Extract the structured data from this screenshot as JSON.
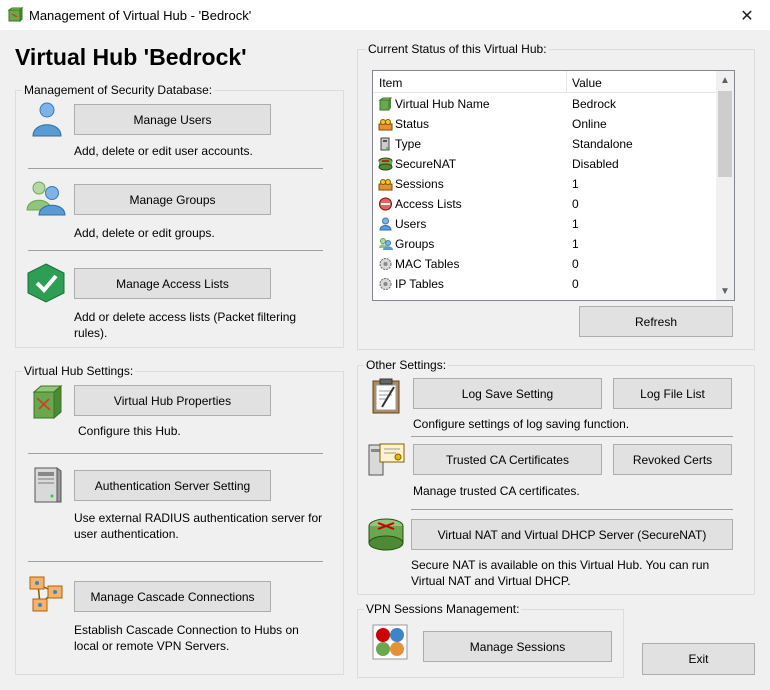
{
  "window": {
    "title": "Management of Virtual Hub - 'Bedrock'",
    "close_glyph": "✕"
  },
  "heading": "Virtual Hub 'Bedrock'",
  "security_db": {
    "label": "Management of Security Database:",
    "manage_users": "Manage Users",
    "users_desc": "Add, delete or edit user accounts.",
    "manage_groups": "Manage Groups",
    "groups_desc": "Add, delete or edit groups.",
    "manage_access": "Manage Access Lists",
    "access_desc": "Add or delete access lists (Packet filtering rules)."
  },
  "hub_settings": {
    "label": "Virtual Hub Settings:",
    "properties": "Virtual Hub Properties",
    "properties_desc": "Configure this Hub.",
    "auth_server": "Authentication Server Setting",
    "auth_desc": "Use external RADIUS authentication server for user authentication.",
    "cascade": "Manage Cascade Connections",
    "cascade_desc": "Establish Cascade Connection to Hubs on local or remote VPN Servers."
  },
  "status": {
    "label": "Current Status of this Virtual Hub:",
    "col_item": "Item",
    "col_value": "Value",
    "rows": [
      {
        "item": "Virtual Hub Name",
        "value": "Bedrock",
        "icon": "hub-icon"
      },
      {
        "item": "Status",
        "value": "Online",
        "icon": "status-icon"
      },
      {
        "item": "Type",
        "value": "Standalone",
        "icon": "type-icon"
      },
      {
        "item": "SecureNAT",
        "value": "Disabled",
        "icon": "securenat-icon"
      },
      {
        "item": "Sessions",
        "value": "1",
        "icon": "sessions-icon"
      },
      {
        "item": "Access Lists",
        "value": "0",
        "icon": "access-list-icon"
      },
      {
        "item": "Users",
        "value": "1",
        "icon": "user-icon"
      },
      {
        "item": "Groups",
        "value": "1",
        "icon": "group-icon"
      },
      {
        "item": "MAC Tables",
        "value": "0",
        "icon": "mac-table-icon"
      },
      {
        "item": "IP Tables",
        "value": "0",
        "icon": "ip-table-icon"
      }
    ],
    "refresh": "Refresh"
  },
  "other_settings": {
    "label": "Other Settings:",
    "log_save": "Log Save Setting",
    "log_list": "Log File List",
    "log_desc": "Configure settings of log saving function.",
    "trusted_ca": "Trusted CA Certificates",
    "revoked": "Revoked Certs",
    "ca_desc": "Manage trusted CA certificates.",
    "securenat": "Virtual NAT and Virtual DHCP Server (SecureNAT)",
    "securenat_desc": "Secure NAT is available on this Virtual Hub. You can run Virtual NAT and Virtual DHCP."
  },
  "vpn_sessions": {
    "label": "VPN Sessions Management:",
    "manage": "Manage Sessions"
  },
  "exit": "Exit"
}
